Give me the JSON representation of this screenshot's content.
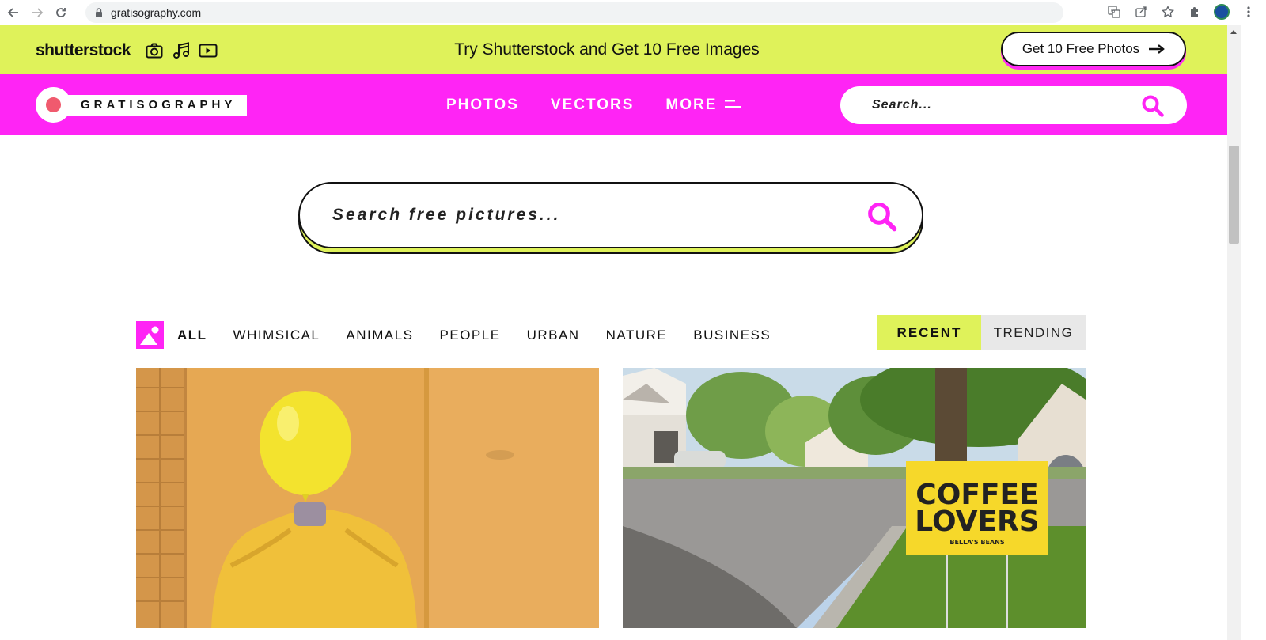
{
  "browser": {
    "url": "gratisography.com",
    "icons": [
      "back-icon",
      "forward-icon",
      "reload-icon",
      "lock-icon",
      "translate-icon",
      "share-icon",
      "star-icon",
      "extensions-icon",
      "profile-icon",
      "menu-icon"
    ]
  },
  "promo": {
    "logo": "shutterstock",
    "headline": "Try Shutterstock and Get 10 Free Images",
    "cta_label": "Get 10 Free Photos",
    "icons": [
      "camera-icon",
      "music-icon",
      "video-icon"
    ],
    "background": "#dff25a"
  },
  "header": {
    "logo_text": "GRATISOGRAPHY",
    "nav": [
      {
        "label": "PHOTOS"
      },
      {
        "label": "VECTORS"
      },
      {
        "label": "MORE"
      }
    ],
    "search_placeholder": "Search...",
    "background": "#ff24f5"
  },
  "hero": {
    "search_placeholder": "Search free pictures..."
  },
  "categories": {
    "items": [
      "ALL",
      "WHIMSICAL",
      "ANIMALS",
      "PEOPLE",
      "URBAN",
      "NATURE",
      "BUSINESS"
    ],
    "active": "ALL"
  },
  "sort": {
    "recent_label": "RECENT",
    "trending_label": "TRENDING",
    "active": "RECENT"
  },
  "photos": [
    {
      "subject": "person in yellow sweater holding yellow balloon over face against orange wall"
    },
    {
      "subject": "yellow yard sign in suburban street",
      "sign_line1": "COFFEE",
      "sign_line2": "LOVERS",
      "sign_line3": "BELLA'S BEANS"
    }
  ],
  "colors": {
    "accent_pink": "#ff24f5",
    "accent_lime": "#dff25a",
    "logo_dot": "#f05a6e"
  }
}
